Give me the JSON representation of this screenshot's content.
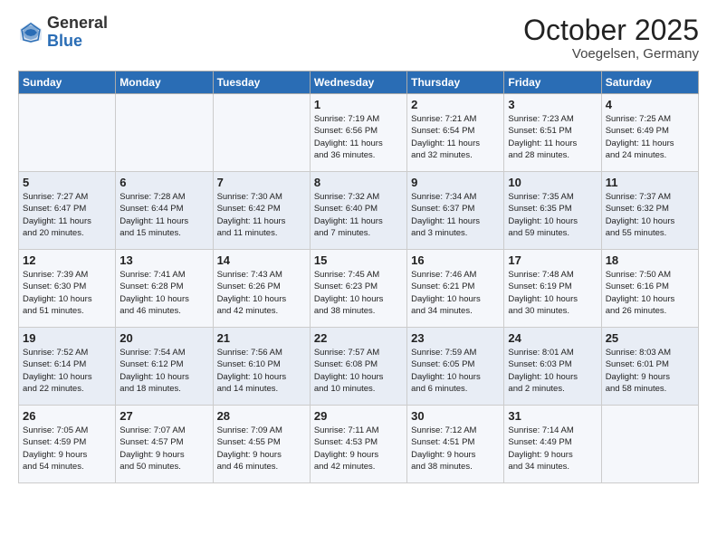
{
  "logo": {
    "general": "General",
    "blue": "Blue"
  },
  "header": {
    "month": "October 2025",
    "location": "Voegelsen, Germany"
  },
  "weekdays": [
    "Sunday",
    "Monday",
    "Tuesday",
    "Wednesday",
    "Thursday",
    "Friday",
    "Saturday"
  ],
  "weeks": [
    [
      {
        "day": "",
        "info": ""
      },
      {
        "day": "",
        "info": ""
      },
      {
        "day": "",
        "info": ""
      },
      {
        "day": "1",
        "info": "Sunrise: 7:19 AM\nSunset: 6:56 PM\nDaylight: 11 hours\nand 36 minutes."
      },
      {
        "day": "2",
        "info": "Sunrise: 7:21 AM\nSunset: 6:54 PM\nDaylight: 11 hours\nand 32 minutes."
      },
      {
        "day": "3",
        "info": "Sunrise: 7:23 AM\nSunset: 6:51 PM\nDaylight: 11 hours\nand 28 minutes."
      },
      {
        "day": "4",
        "info": "Sunrise: 7:25 AM\nSunset: 6:49 PM\nDaylight: 11 hours\nand 24 minutes."
      }
    ],
    [
      {
        "day": "5",
        "info": "Sunrise: 7:27 AM\nSunset: 6:47 PM\nDaylight: 11 hours\nand 20 minutes."
      },
      {
        "day": "6",
        "info": "Sunrise: 7:28 AM\nSunset: 6:44 PM\nDaylight: 11 hours\nand 15 minutes."
      },
      {
        "day": "7",
        "info": "Sunrise: 7:30 AM\nSunset: 6:42 PM\nDaylight: 11 hours\nand 11 minutes."
      },
      {
        "day": "8",
        "info": "Sunrise: 7:32 AM\nSunset: 6:40 PM\nDaylight: 11 hours\nand 7 minutes."
      },
      {
        "day": "9",
        "info": "Sunrise: 7:34 AM\nSunset: 6:37 PM\nDaylight: 11 hours\nand 3 minutes."
      },
      {
        "day": "10",
        "info": "Sunrise: 7:35 AM\nSunset: 6:35 PM\nDaylight: 10 hours\nand 59 minutes."
      },
      {
        "day": "11",
        "info": "Sunrise: 7:37 AM\nSunset: 6:32 PM\nDaylight: 10 hours\nand 55 minutes."
      }
    ],
    [
      {
        "day": "12",
        "info": "Sunrise: 7:39 AM\nSunset: 6:30 PM\nDaylight: 10 hours\nand 51 minutes."
      },
      {
        "day": "13",
        "info": "Sunrise: 7:41 AM\nSunset: 6:28 PM\nDaylight: 10 hours\nand 46 minutes."
      },
      {
        "day": "14",
        "info": "Sunrise: 7:43 AM\nSunset: 6:26 PM\nDaylight: 10 hours\nand 42 minutes."
      },
      {
        "day": "15",
        "info": "Sunrise: 7:45 AM\nSunset: 6:23 PM\nDaylight: 10 hours\nand 38 minutes."
      },
      {
        "day": "16",
        "info": "Sunrise: 7:46 AM\nSunset: 6:21 PM\nDaylight: 10 hours\nand 34 minutes."
      },
      {
        "day": "17",
        "info": "Sunrise: 7:48 AM\nSunset: 6:19 PM\nDaylight: 10 hours\nand 30 minutes."
      },
      {
        "day": "18",
        "info": "Sunrise: 7:50 AM\nSunset: 6:16 PM\nDaylight: 10 hours\nand 26 minutes."
      }
    ],
    [
      {
        "day": "19",
        "info": "Sunrise: 7:52 AM\nSunset: 6:14 PM\nDaylight: 10 hours\nand 22 minutes."
      },
      {
        "day": "20",
        "info": "Sunrise: 7:54 AM\nSunset: 6:12 PM\nDaylight: 10 hours\nand 18 minutes."
      },
      {
        "day": "21",
        "info": "Sunrise: 7:56 AM\nSunset: 6:10 PM\nDaylight: 10 hours\nand 14 minutes."
      },
      {
        "day": "22",
        "info": "Sunrise: 7:57 AM\nSunset: 6:08 PM\nDaylight: 10 hours\nand 10 minutes."
      },
      {
        "day": "23",
        "info": "Sunrise: 7:59 AM\nSunset: 6:05 PM\nDaylight: 10 hours\nand 6 minutes."
      },
      {
        "day": "24",
        "info": "Sunrise: 8:01 AM\nSunset: 6:03 PM\nDaylight: 10 hours\nand 2 minutes."
      },
      {
        "day": "25",
        "info": "Sunrise: 8:03 AM\nSunset: 6:01 PM\nDaylight: 9 hours\nand 58 minutes."
      }
    ],
    [
      {
        "day": "26",
        "info": "Sunrise: 7:05 AM\nSunset: 4:59 PM\nDaylight: 9 hours\nand 54 minutes."
      },
      {
        "day": "27",
        "info": "Sunrise: 7:07 AM\nSunset: 4:57 PM\nDaylight: 9 hours\nand 50 minutes."
      },
      {
        "day": "28",
        "info": "Sunrise: 7:09 AM\nSunset: 4:55 PM\nDaylight: 9 hours\nand 46 minutes."
      },
      {
        "day": "29",
        "info": "Sunrise: 7:11 AM\nSunset: 4:53 PM\nDaylight: 9 hours\nand 42 minutes."
      },
      {
        "day": "30",
        "info": "Sunrise: 7:12 AM\nSunset: 4:51 PM\nDaylight: 9 hours\nand 38 minutes."
      },
      {
        "day": "31",
        "info": "Sunrise: 7:14 AM\nSunset: 4:49 PM\nDaylight: 9 hours\nand 34 minutes."
      },
      {
        "day": "",
        "info": ""
      }
    ]
  ]
}
